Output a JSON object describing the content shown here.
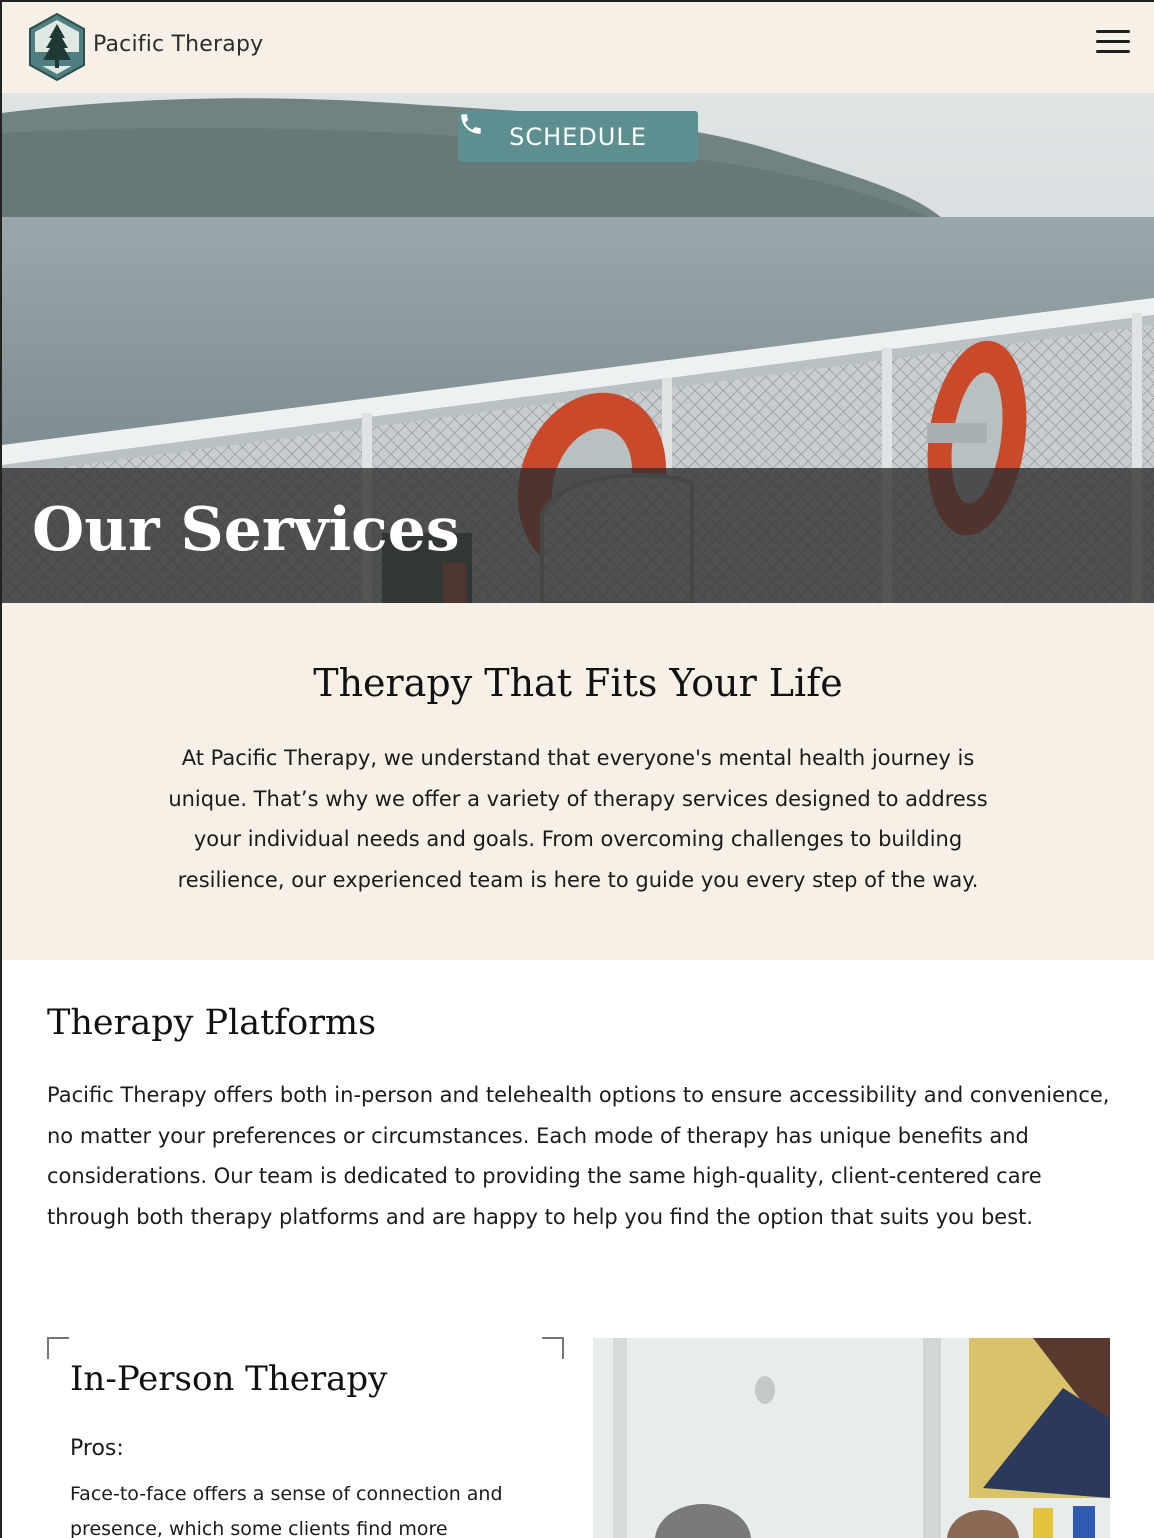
{
  "header": {
    "brand": "Pacific Therapy",
    "menu_icon": "hamburger-menu-icon",
    "logo_icon": "pine-tree-hexagon-logo"
  },
  "hero": {
    "schedule_label": "SCHEDULE",
    "schedule_icon": "phone-icon",
    "title": "Our Services"
  },
  "intro": {
    "heading": "Therapy That Fits Your Life",
    "body": "At Pacific Therapy, we understand that everyone's mental health journey is unique. That’s why we offer a variety of therapy services designed to address your individual needs and goals. From overcoming challenges to building resilience, our experienced team is here to guide you every step of the way."
  },
  "platforms": {
    "heading": "Therapy Platforms",
    "body": "Pacific Therapy offers both in-person and telehealth options to ensure accessibility and convenience, no matter your preferences or circumstances. Each mode of therapy has unique benefits and considerations. Our team is dedicated to providing the same high-quality, client-centered care through both therapy platforms and are happy to help you find the option that suits you best."
  },
  "in_person": {
    "heading": "In-Person Therapy",
    "pros_label": "Pros:",
    "pros_text": "Face-to-face offers a sense of connection and presence, which some clients find more"
  },
  "colors": {
    "cream": "#f6f0e6",
    "teal": "#5e8f90",
    "dark_band": "#2d2d2d"
  }
}
